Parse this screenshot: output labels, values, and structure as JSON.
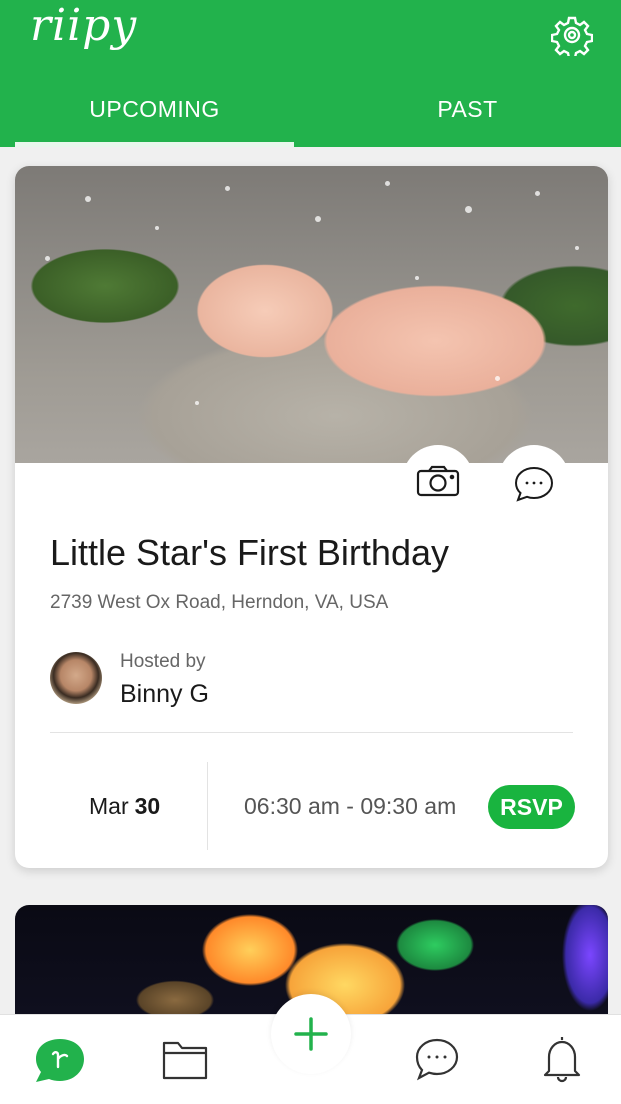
{
  "app": {
    "logo_text": "riipy",
    "brand_color": "#22b24c",
    "accent_color": "#19b43f"
  },
  "header": {
    "settings_icon": "gear-icon",
    "tabs": [
      {
        "label": "UPCOMING",
        "active": true
      },
      {
        "label": "PAST",
        "active": false
      }
    ]
  },
  "event": {
    "image_alt": "baby with flower crown",
    "photo_icon": "camera-icon",
    "comment_icon": "chat-bubble-icon",
    "title": "Little Star's First Birthday",
    "address": "2739 West Ox Road, Herndon, VA, USA",
    "hosted_by_label": "Hosted by",
    "host_name": "Binny G",
    "month": "Mar",
    "day": "30",
    "time_range": "06:30 am - 09:30 am",
    "rsvp_label": "RSVP"
  },
  "bottom_nav": {
    "items": [
      {
        "icon": "riipy-home-icon",
        "active": true
      },
      {
        "icon": "folder-icon"
      },
      {
        "icon": "plus-icon"
      },
      {
        "icon": "chat-bubble-icon"
      },
      {
        "icon": "bell-icon"
      }
    ]
  }
}
